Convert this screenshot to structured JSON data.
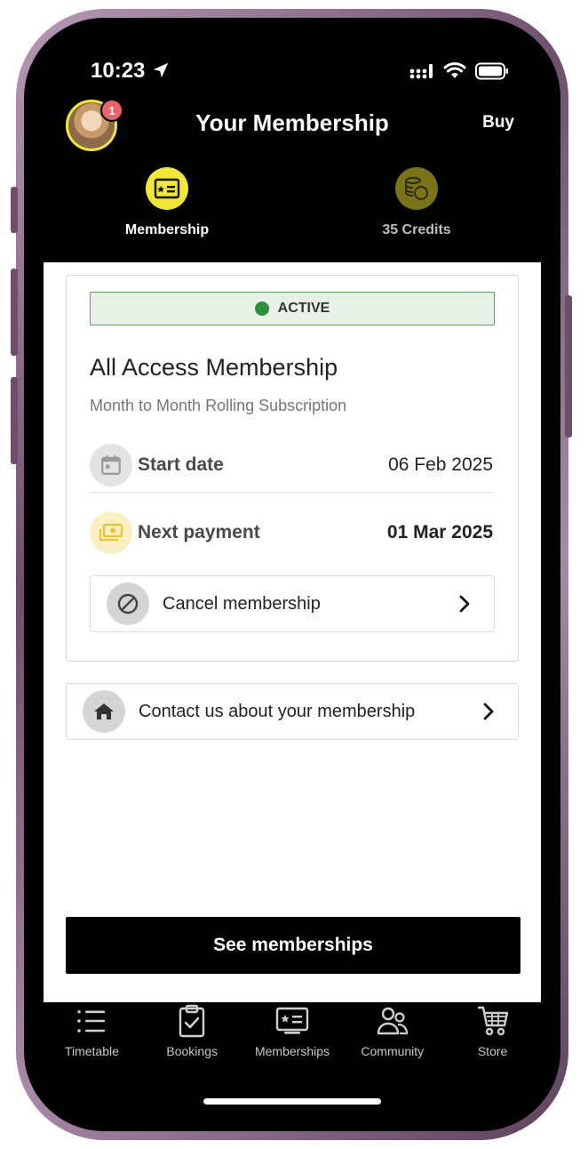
{
  "status_bar": {
    "time": "10:23"
  },
  "header": {
    "title": "Your Membership",
    "buy_label": "Buy",
    "notification_count": "1"
  },
  "segments": [
    {
      "label": "Membership",
      "icon": "membership-card-icon",
      "active": true
    },
    {
      "label": "35 Credits",
      "icon": "credits-coins-icon",
      "active": false
    }
  ],
  "membership": {
    "status": "ACTIVE",
    "name": "All Access Membership",
    "subtitle": "Month to Month Rolling Subscription",
    "start_date_label": "Start date",
    "start_date": "06 Feb 2025",
    "next_payment_label": "Next payment",
    "next_payment": "01 Mar 2025",
    "cancel_label": "Cancel membership"
  },
  "contact_label": "Contact us about your membership",
  "see_memberships_label": "See memberships",
  "tabs": [
    {
      "label": "Timetable",
      "icon": "timetable-list-icon"
    },
    {
      "label": "Bookings",
      "icon": "bookings-clipboard-icon"
    },
    {
      "label": "Memberships",
      "icon": "membership-card-icon"
    },
    {
      "label": "Community",
      "icon": "community-people-icon"
    },
    {
      "label": "Store",
      "icon": "shopping-cart-icon"
    }
  ],
  "colors": {
    "accent_yellow": "#f0e736",
    "credits_olive": "#7a7416",
    "active_green": "#2f8f3a",
    "active_bg": "#e7f1e7",
    "badge_red": "#e8636a"
  }
}
